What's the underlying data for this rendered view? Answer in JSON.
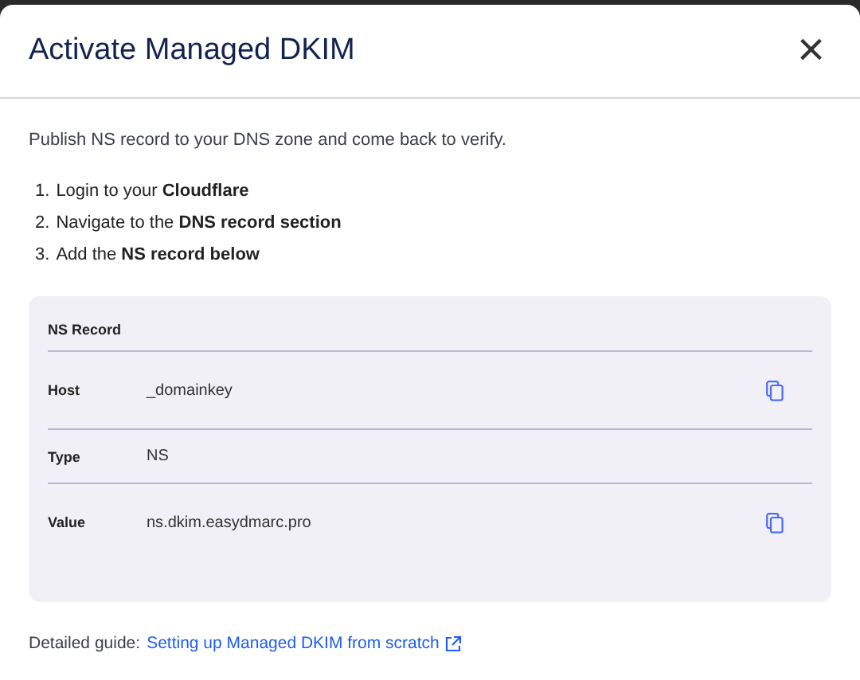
{
  "dialog": {
    "title": "Activate Managed DKIM",
    "close_label": "×"
  },
  "intro": "Publish NS record to your DNS zone and come back to verify.",
  "steps": [
    {
      "number": "1.",
      "text": "Login to your **Cloudflare**"
    },
    {
      "number": "2.",
      "text": "Navigate to the **DNS record section**"
    },
    {
      "number": "3.",
      "text": "Add the **NS record below**"
    }
  ],
  "record": {
    "title": "NS Record",
    "rows": [
      {
        "label": "Host",
        "value": "_domainkey",
        "copyable": true
      },
      {
        "label": "Type",
        "value": "NS",
        "copyable": false
      },
      {
        "label": "Value",
        "value": "ns.dkim.easydmarc.pro",
        "copyable": true
      }
    ]
  },
  "guide": {
    "prefix": "Detailed guide:",
    "link": "Setting up Managed DKIM from scratch"
  }
}
